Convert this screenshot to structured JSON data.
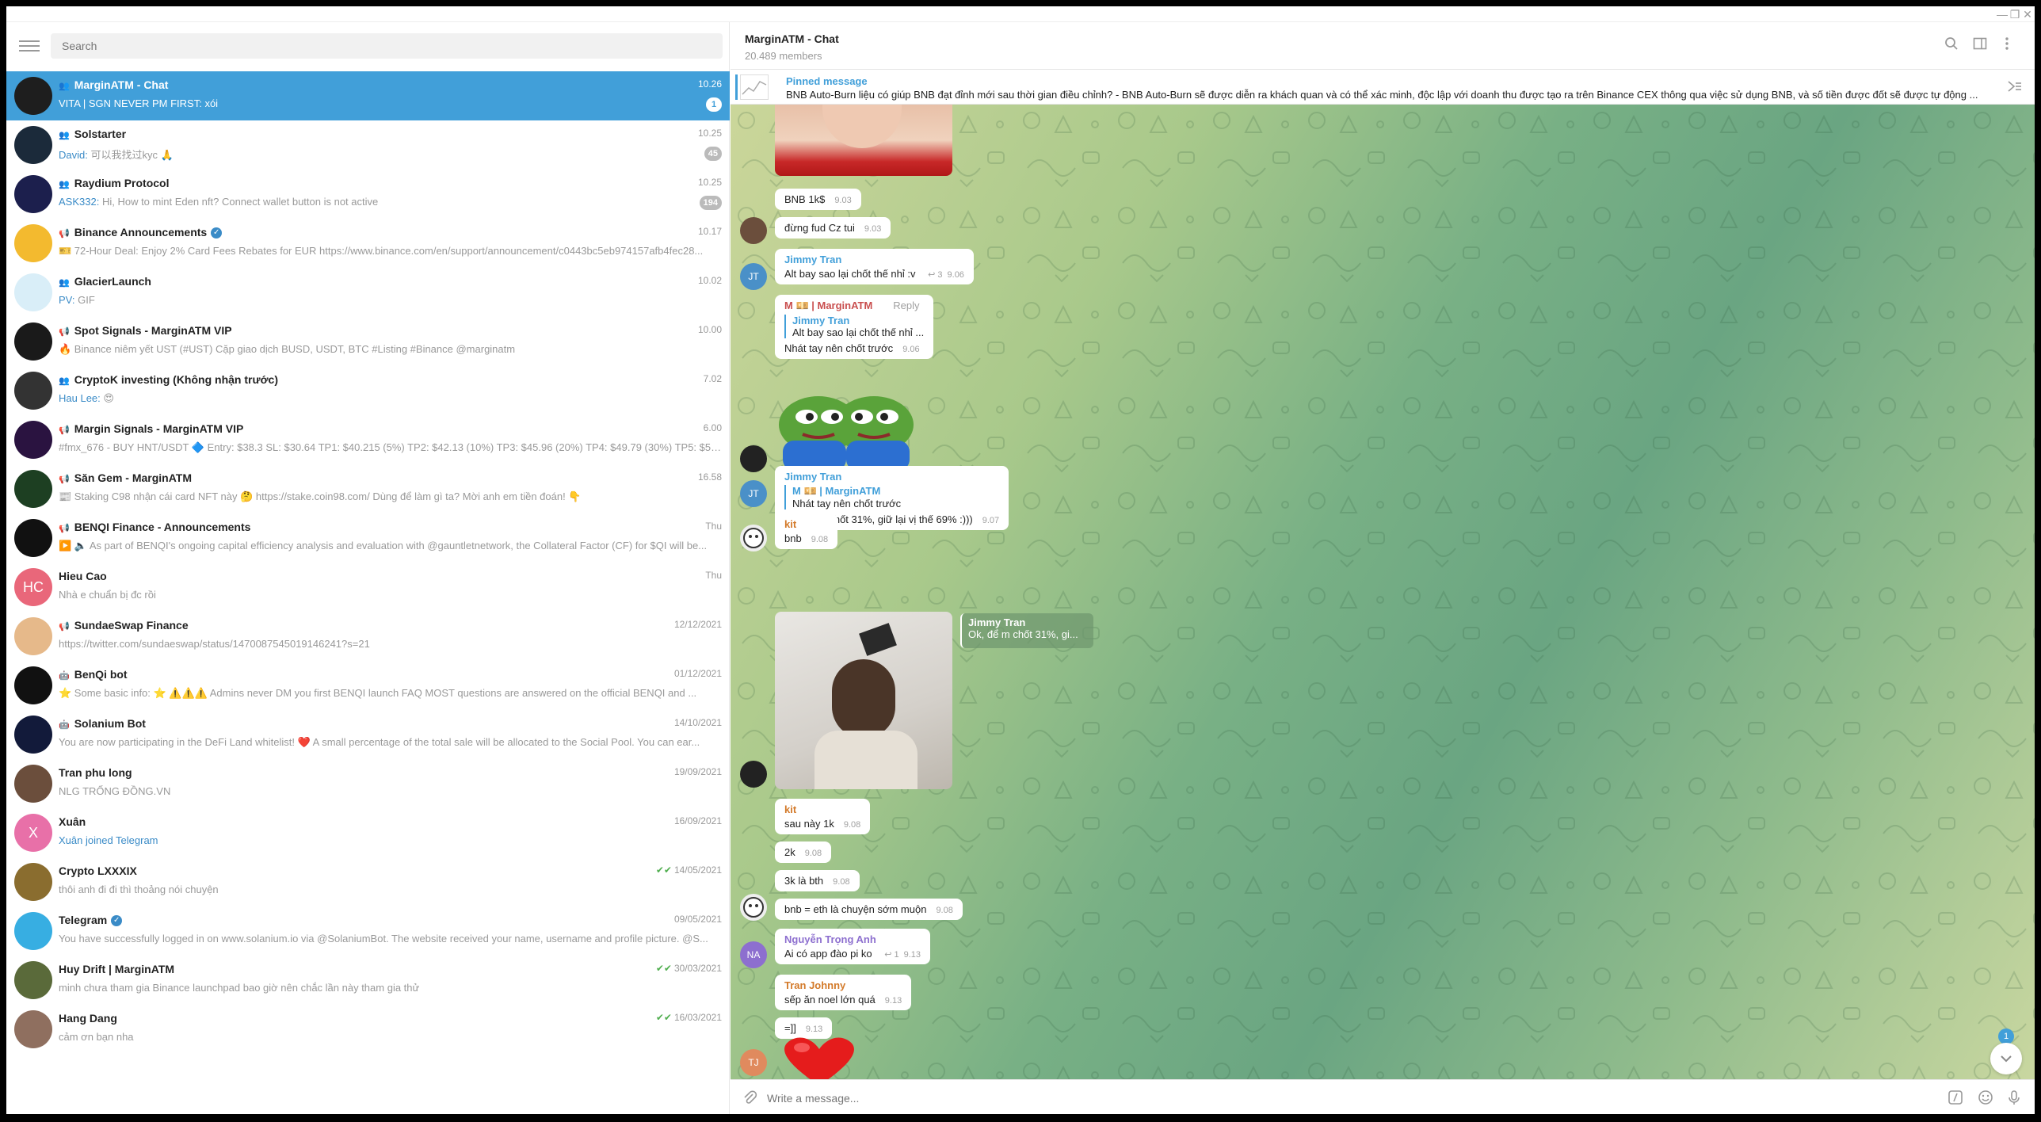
{
  "window": {
    "minimize": "—",
    "maximize": "❐",
    "close": "✕"
  },
  "sidebar": {
    "search_placeholder": "Search",
    "chats": [
      {
        "name": "MarginATM - Chat",
        "icon": "group",
        "time": "10.26",
        "sender": "",
        "message": "VITA | SGN NEVER PM FIRST: xói",
        "badge": "1",
        "avatar_bg": "#1e1e1e",
        "initials": "",
        "active": true
      },
      {
        "name": "Solstarter",
        "icon": "group",
        "time": "10.25",
        "sender": "David:",
        "message": "可以我找过kyc 🙏",
        "badge": "45",
        "avatar_bg": "#1b2a3a",
        "initials": ""
      },
      {
        "name": "Raydium Protocol",
        "icon": "group",
        "time": "10.25",
        "sender": "ASK332:",
        "message": "Hi, How to mint Eden nft? Connect wallet button is not active",
        "badge": "194",
        "avatar_bg": "#1c1f4d",
        "initials": ""
      },
      {
        "name": "Binance Announcements",
        "icon": "channel",
        "verified": true,
        "time": "10.17",
        "sender": "",
        "message": "🎫 72-Hour Deal: Enjoy 2% Card Fees Rebates for EUR  https://www.binance.com/en/support/announcement/c0443bc5eb974157afb4fec28...",
        "badge": "",
        "avatar_bg": "#f3ba2f",
        "initials": ""
      },
      {
        "name": "GlacierLaunch",
        "icon": "group",
        "time": "10.02",
        "sender": "PV:",
        "message": "GIF",
        "badge": "",
        "avatar_bg": "#d9eef8",
        "initials": ""
      },
      {
        "name": "Spot Signals - MarginATM VIP",
        "icon": "channel",
        "time": "10.00",
        "sender": "",
        "message": "🔥 Binance niêm yết UST (#UST) Cặp giao dịch BUSD, USDT, BTC  #Listing #Binance @marginatm",
        "badge": "",
        "avatar_bg": "#1a1a1a",
        "initials": ""
      },
      {
        "name": "CryptoK investing (Không nhận trước)",
        "icon": "group",
        "time": "7.02",
        "sender": "Hau Lee:",
        "message": "😍",
        "badge": "",
        "avatar_bg": "#333",
        "initials": ""
      },
      {
        "name": "Margin Signals - MarginATM VIP",
        "icon": "channel",
        "time": "6.00",
        "sender": "",
        "message": "#fmx_676 - BUY HNT/USDT 🔷  Entry: $38.3 SL: $30.64  TP1: $40.215 (5%) TP2: $42.13 (10%) TP3: $45.96 (20%) TP4: $49.79 (30%) TP5: $57.45 (5...",
        "badge": "",
        "avatar_bg": "#2a1340",
        "initials": ""
      },
      {
        "name": "Săn Gem - MarginATM",
        "icon": "channel",
        "time": "16.58",
        "sender": "",
        "message": "📰 Staking C98 nhận cái card NFT này 🤔  https://stake.coin98.com/  Dùng để làm gì ta? Mời anh em tiền đoán! 👇",
        "badge": "",
        "avatar_bg": "#1d3f22",
        "initials": ""
      },
      {
        "name": "BENQI Finance - Announcements",
        "icon": "channel",
        "time": "Thu",
        "sender": "",
        "message": "▶️ 🔈 As part of BENQI's ongoing capital efficiency analysis and evaluation with @gauntletnetwork, the Collateral Factor (CF) for $QI will be...",
        "badge": "",
        "avatar_bg": "#111",
        "initials": ""
      },
      {
        "name": "Hieu Cao",
        "icon": "",
        "time": "Thu",
        "sender": "",
        "message": "Nhà e chuẩn bị đc rồi",
        "badge": "",
        "avatar_bg": "#e9677a",
        "initials": "HC"
      },
      {
        "name": "SundaeSwap Finance",
        "icon": "channel",
        "time": "12/12/2021",
        "sender": "",
        "message": "https://twitter.com/sundaeswap/status/1470087545019146241?s=21",
        "badge": "",
        "avatar_bg": "#e6b98a",
        "initials": ""
      },
      {
        "name": "BenQi bot",
        "icon": "bot",
        "time": "01/12/2021",
        "sender": "",
        "message": "⭐ Some basic info: ⭐  ⚠️⚠️⚠️ Admins never DM you first  BENQI launch FAQ  MOST questions are answered on the official BENQI and ...",
        "badge": "",
        "avatar_bg": "#111",
        "initials": ""
      },
      {
        "name": "Solanium Bot",
        "icon": "bot",
        "time": "14/10/2021",
        "sender": "",
        "message": "You are now participating in the DeFi Land whitelist! ❤️  A small percentage of the total sale will be allocated to the Social Pool. You can ear...",
        "badge": "",
        "avatar_bg": "#121a3a",
        "initials": ""
      },
      {
        "name": "Tran phu long",
        "icon": "",
        "time": "19/09/2021",
        "sender": "",
        "message": "NLG TRỐNG ĐỒNG.VN",
        "badge": "",
        "avatar_bg": "#6b4e3c",
        "initials": ""
      },
      {
        "name": "Xuân",
        "icon": "",
        "time": "16/09/2021",
        "sender": "Xuân joined Telegram",
        "message": "",
        "badge": "",
        "avatar_bg": "#e870a8",
        "initials": "X"
      },
      {
        "name": "Crypto LXXXIX",
        "icon": "",
        "time": "14/05/2021",
        "ticks": true,
        "sender": "",
        "message": "thôi anh đi đi thì thoảng nói chuyện",
        "badge": "",
        "avatar_bg": "#8a6d2f",
        "initials": ""
      },
      {
        "name": "Telegram",
        "icon": "",
        "verified": true,
        "time": "09/05/2021",
        "sender": "",
        "message": "You have successfully logged in on www.solanium.io via @SolaniumBot. The website received your name, username and profile picture. @S...",
        "badge": "",
        "avatar_bg": "#37aee2",
        "initials": ""
      },
      {
        "name": "Huy Drift | MarginATM",
        "icon": "",
        "time": "30/03/2021",
        "ticks": true,
        "sender": "",
        "message": "minh chưa tham gia Binance launchpad bao giờ nên chắc lần này tham gia thử",
        "badge": "",
        "avatar_bg": "#5a6a3a",
        "initials": ""
      },
      {
        "name": "Hang Dang",
        "icon": "",
        "time": "16/03/2021",
        "ticks": true,
        "sender": "",
        "message": "cảm ơn bạn nha",
        "badge": "",
        "avatar_bg": "#8f6f5f",
        "initials": ""
      }
    ]
  },
  "chat": {
    "title": "MarginATM - Chat",
    "members": "20.489 members",
    "pinned_label": "Pinned message",
    "pinned_text": "BNB Auto-Burn liệu có giúp BNB đạt đỉnh mới sau thời gian điều chỉnh?  - BNB Auto-Burn sẽ được diễn ra khách quan và có thể xác minh, độc lập với doanh thu được tạo ra trên Binance CEX thông qua việc sử dụng BNB, và số tiền được đốt sẽ được tự động ...",
    "input_placeholder": "Write a message...",
    "unread": "1",
    "messages": {
      "m1": {
        "text": "BNB 1k$",
        "time": "9.03"
      },
      "m2": {
        "text": "đừng fud Cz tui",
        "time": "9.03"
      },
      "m3": {
        "name": "Jimmy Tran",
        "text": "Alt bay sao lại chốt thế nhỉ :v",
        "replies": "3",
        "time": "9.06"
      },
      "m4": {
        "name": "M 💴 | MarginATM",
        "reply_label": "Reply",
        "quote_name": "Jimmy Tran",
        "quote_text": "Alt bay sao lại chốt thế nhỉ ...",
        "text": "Nhát tay nên chốt trước",
        "time": "9.06"
      },
      "m5": {
        "name": "Jimmy Tran",
        "quote_name": "M 💴 | MarginATM",
        "quote_text": "Nhát tay nên chốt trước",
        "text": "Ok, để m chốt 31%, giữ lại vị thế 69% :)))",
        "time": "9.07"
      },
      "m6": {
        "name": "kit",
        "text": "bnb",
        "time": "9.08"
      },
      "m7": {
        "quote_name": "Jimmy Tran",
        "quote_text": "Ok, để m chốt 31%, gi..."
      },
      "m8": {
        "name": "kit",
        "text": "sau này 1k",
        "time": "9.08"
      },
      "m9": {
        "text": "2k",
        "time": "9.08"
      },
      "m10": {
        "text": "3k là bth",
        "time": "9.08"
      },
      "m11": {
        "text": "bnb = eth là chuyện sớm muộn",
        "time": "9.08"
      },
      "m12": {
        "name": "Nguyễn Trọng Anh",
        "text": "Ai có app đào pi ko",
        "replies": "1",
        "time": "9.13"
      },
      "m13": {
        "name": "Tran Johnny",
        "text": "sếp ăn noel lớn quá",
        "time": "9.13"
      },
      "m14": {
        "text": "=]]",
        "time": "9.13"
      }
    },
    "avatars": {
      "jt": "JT",
      "na": "NA",
      "tj": "TJ"
    }
  },
  "colors": {
    "accent": "#419fd9",
    "active_row": "#419fd9",
    "jt": "#4a90c8",
    "na": "#8d6fcf",
    "tj": "#e08a5e",
    "kit_name": "#d37a2a",
    "anh_name": "#8d6fcf",
    "johnny_name": "#d37a2a"
  }
}
